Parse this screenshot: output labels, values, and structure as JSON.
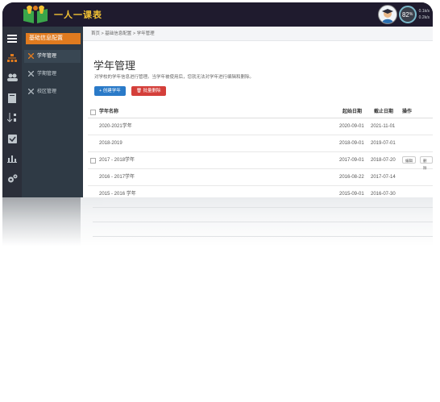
{
  "app": {
    "logo_text": "一人一课表",
    "battery_percent": "82",
    "battery_suffix": "%",
    "net_up": "0.1k/s",
    "net_down": "0.2k/s"
  },
  "sidebar": {
    "header": "基础信息配置",
    "items": [
      {
        "label": "学年管理",
        "active": true
      },
      {
        "label": "学期管理",
        "active": false
      },
      {
        "label": "校区管理",
        "active": false
      }
    ]
  },
  "breadcrumb": {
    "items": [
      "首页",
      "基础信息配置",
      "学年管理"
    ],
    "separator": ">"
  },
  "page": {
    "title": "学年管理",
    "description": "对学校的学年信息进行管理。当学年被使用后，您就无法对学年进行编辑和删除。",
    "create_button": "创建学年",
    "delete_button": "批量删除"
  },
  "table": {
    "headers": {
      "name": "学年名称",
      "start": "起始日期",
      "end": "截止日期",
      "ops": "操作"
    },
    "rows": [
      {
        "name": "2020-2021学年",
        "start": "2020-09-01",
        "end": "2021-11-01",
        "has_checkbox": false,
        "ops": []
      },
      {
        "name": "2018-2019",
        "start": "2018-09-01",
        "end": "2019-07-01",
        "has_checkbox": false,
        "ops": []
      },
      {
        "name": "2017 - 2018学年",
        "start": "2017-09-01",
        "end": "2018-07-20",
        "has_checkbox": true,
        "ops": [
          "编辑",
          "删除"
        ]
      },
      {
        "name": "2016 - 2017学年",
        "start": "2016-08-22",
        "end": "2017-07-14",
        "has_checkbox": false,
        "ops": []
      },
      {
        "name": "2015 - 2016 学年",
        "start": "2015-09-01",
        "end": "2016-07-30",
        "has_checkbox": false,
        "ops": []
      }
    ]
  },
  "colors": {
    "topbar": "#1f1b2e",
    "sidebar": "#2f3a45",
    "accent_orange": "#e07b1f",
    "primary_blue": "#2a7ac8",
    "danger_red": "#d43f3a",
    "logo_yellow": "#f2c233"
  }
}
